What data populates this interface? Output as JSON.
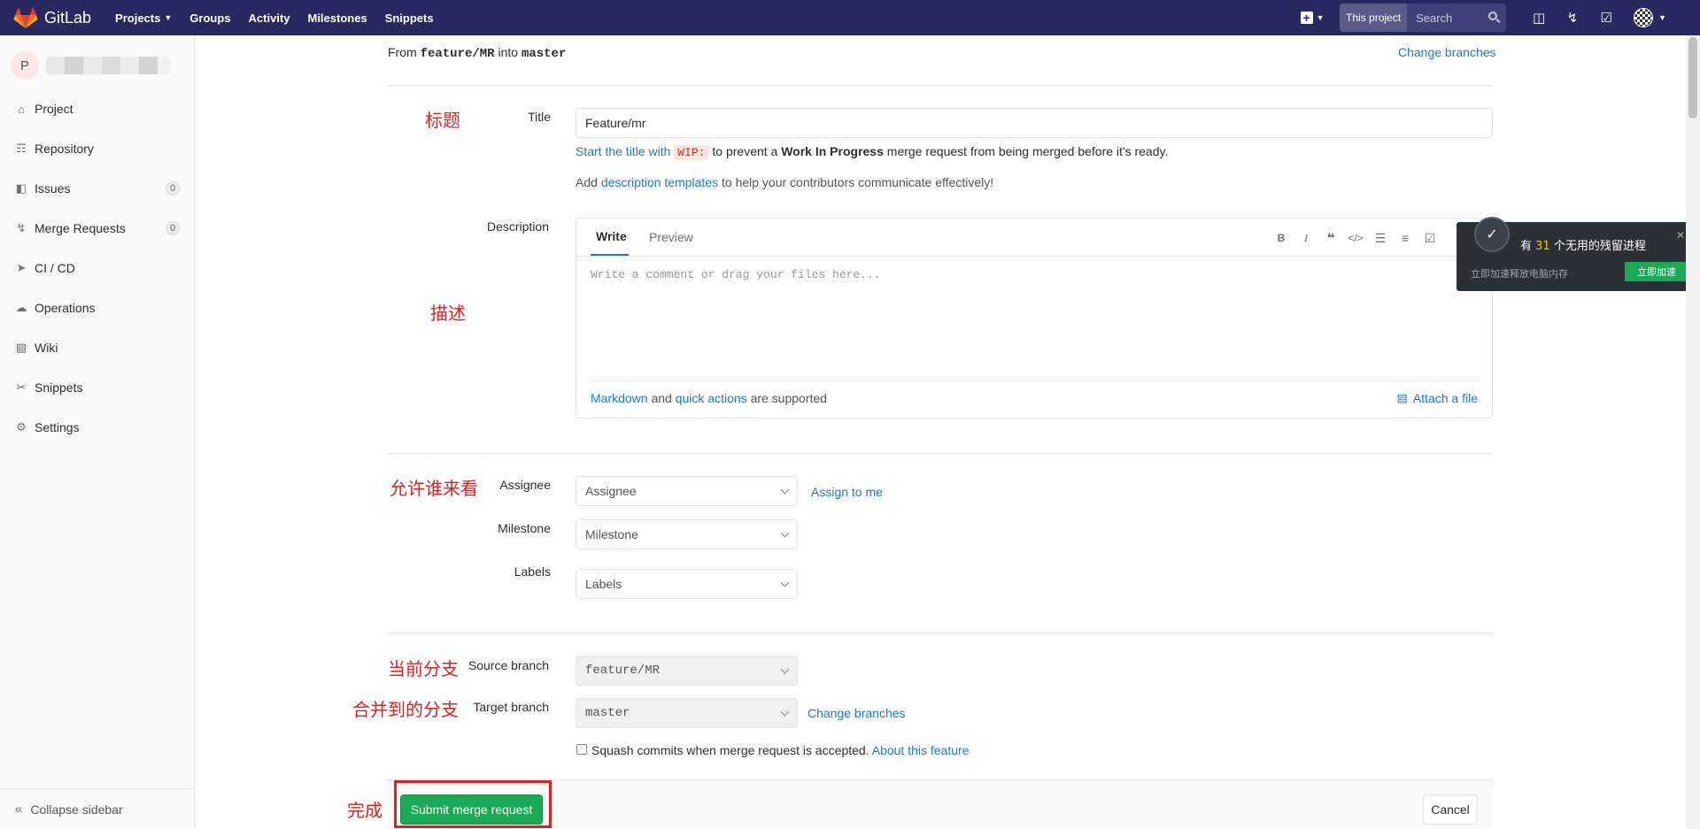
{
  "navbar": {
    "brand": "GitLab",
    "links": [
      {
        "label": "Projects",
        "dropdown": true
      },
      {
        "label": "Groups"
      },
      {
        "label": "Activity"
      },
      {
        "label": "Milestones"
      },
      {
        "label": "Snippets"
      }
    ],
    "search_scope": "This project",
    "search_placeholder": "Search"
  },
  "sidebar": {
    "project_initial": "P",
    "items": [
      {
        "label": "Project",
        "icon": "home-icon"
      },
      {
        "label": "Repository",
        "icon": "book-icon"
      },
      {
        "label": "Issues",
        "icon": "issues-icon",
        "count": "0"
      },
      {
        "label": "Merge Requests",
        "icon": "merge-request-icon",
        "count": "0"
      },
      {
        "label": "CI / CD",
        "icon": "rocket-icon"
      },
      {
        "label": "Operations",
        "icon": "cloud-gear-icon"
      },
      {
        "label": "Wiki",
        "icon": "wiki-book-icon"
      },
      {
        "label": "Snippets",
        "icon": "scissors-icon"
      },
      {
        "label": "Settings",
        "icon": "gear-icon"
      }
    ],
    "collapse_label": "Collapse sidebar"
  },
  "form": {
    "from_prefix": "From",
    "source_branch_code": "feature/MR",
    "into_word": "into",
    "target_branch_code": "master",
    "change_branches_top": "Change branches",
    "title_label": "Title",
    "title_value": "Feature/mr",
    "title_hint_link": "Start the title with",
    "wip_code": "WIP:",
    "title_hint_mid": "to prevent a",
    "title_hint_bold": "Work In Progress",
    "title_hint_end": "merge request from being merged before it's ready.",
    "templates_prefix": "Add",
    "templates_link": "description templates",
    "templates_suffix": "to help your contributors communicate effectively!",
    "description_label": "Description",
    "tab_write": "Write",
    "tab_preview": "Preview",
    "description_placeholder": "Write a comment or drag your files here...",
    "markdown_link": "Markdown",
    "and_word": "and",
    "quick_actions_link": "quick actions",
    "supported_text": "are supported",
    "attach_file": "Attach a file",
    "assignee_label": "Assignee",
    "assignee_value": "Assignee",
    "assign_to_me": "Assign to me",
    "milestone_label": "Milestone",
    "milestone_value": "Milestone",
    "labels_label": "Labels",
    "labels_value": "Labels",
    "source_branch_label": "Source branch",
    "source_branch_value": "feature/MR",
    "target_branch_label": "Target branch",
    "target_branch_value": "master",
    "change_branches_bottom": "Change branches",
    "squash_text": "Squash commits when merge request is accepted.",
    "about_feature": "About this feature",
    "submit_label": "Submit merge request",
    "cancel_label": "Cancel"
  },
  "annotations": {
    "title_cn": "标题",
    "description_cn": "描述",
    "assignee_cn": "允许谁来看",
    "source_cn": "当前分支",
    "target_cn": "合并到的分支",
    "done_cn": "完成"
  },
  "popup": {
    "title_prefix": "有",
    "count": "31",
    "title_suffix": "个无用的残留进程",
    "subtitle": "立即加速释放电脑内存",
    "button": "立即加速"
  },
  "colors": {
    "navbar_bg": "#292961",
    "link": "#1f78d1",
    "submit": "#1aaa55",
    "annotation": "#e02020"
  }
}
